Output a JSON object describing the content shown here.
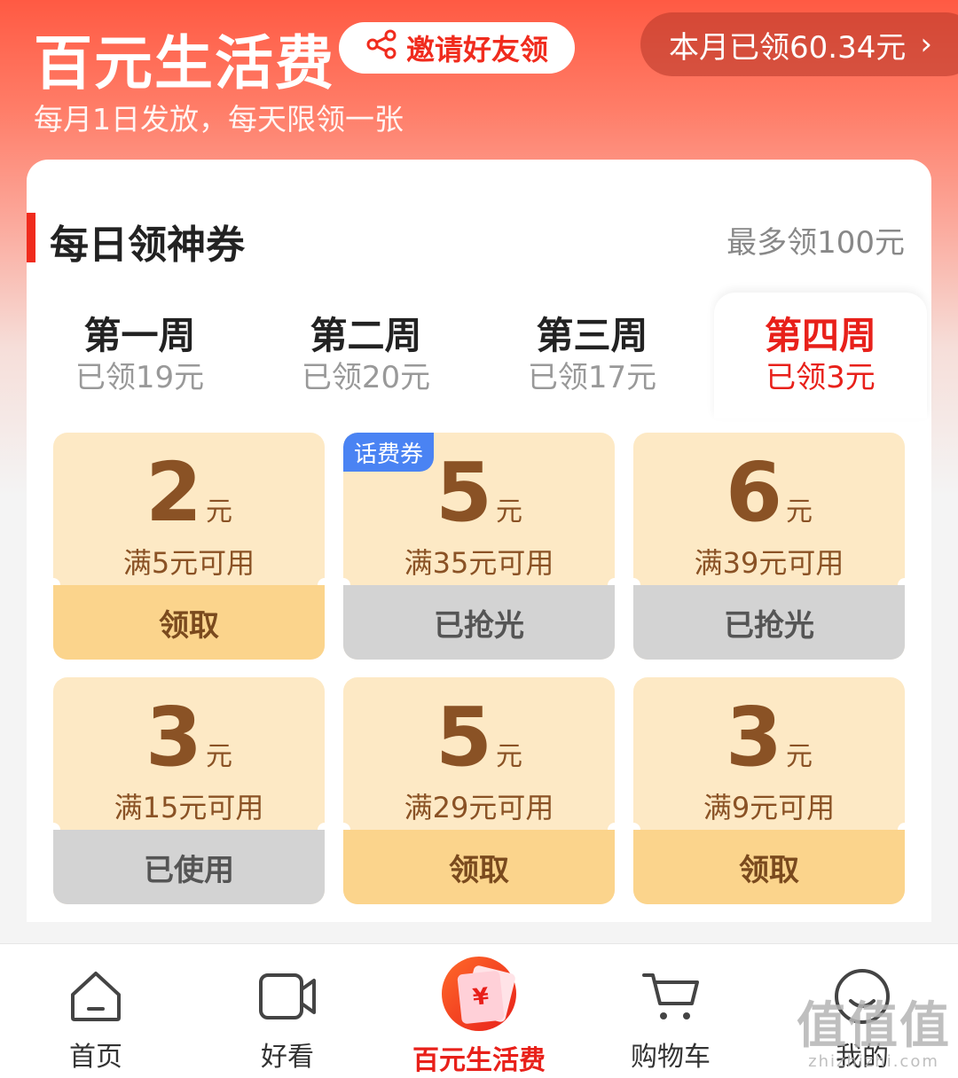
{
  "header": {
    "title": "百元生活费",
    "invite_label": "邀请好友领",
    "month_claimed": "本月已领60.34元",
    "month_chevron": "›",
    "subtitle": "每月1日发放，每天限领一张"
  },
  "card": {
    "title": "每日领神券",
    "max_note": "最多领100元"
  },
  "weeks": [
    {
      "name": "第一周",
      "claimed": "已领19元",
      "active": false
    },
    {
      "name": "第二周",
      "claimed": "已领20元",
      "active": false
    },
    {
      "name": "第三周",
      "claimed": "已领17元",
      "active": false
    },
    {
      "name": "第四周",
      "claimed": "已领3元",
      "active": true
    }
  ],
  "coupons": [
    {
      "amount": "2",
      "unit": "元",
      "condition": "满5元可用",
      "action": "领取",
      "state": "claim",
      "tag": ""
    },
    {
      "amount": "5",
      "unit": "元",
      "condition": "满35元可用",
      "action": "已抢光",
      "state": "gone",
      "tag": "话费券"
    },
    {
      "amount": "6",
      "unit": "元",
      "condition": "满39元可用",
      "action": "已抢光",
      "state": "gone",
      "tag": ""
    },
    {
      "amount": "3",
      "unit": "元",
      "condition": "满15元可用",
      "action": "已使用",
      "state": "gone",
      "tag": ""
    },
    {
      "amount": "5",
      "unit": "元",
      "condition": "满29元可用",
      "action": "领取",
      "state": "claim",
      "tag": ""
    },
    {
      "amount": "3",
      "unit": "元",
      "condition": "满9元可用",
      "action": "领取",
      "state": "claim",
      "tag": ""
    }
  ],
  "nav": [
    {
      "label": "首页",
      "icon": "home-icon",
      "active": false
    },
    {
      "label": "好看",
      "icon": "video-camera-icon",
      "active": false
    },
    {
      "label": "百元生活费",
      "icon": "red-envelope-icon",
      "active": true,
      "icon_text": "¥"
    },
    {
      "label": "购物车",
      "icon": "shopping-cart-icon",
      "active": false
    },
    {
      "label": "我的",
      "icon": "smiley-face-icon",
      "active": false
    }
  ],
  "watermark": {
    "big": "值值值",
    "small": "zhizhizhi.com"
  },
  "colors": {
    "brand_red": "#e8201a",
    "coupon_bg": "#fde9c5",
    "coupon_claim": "#fbd48c",
    "coupon_gone": "#d3d3d3",
    "tag_blue": "#4a83f3"
  }
}
